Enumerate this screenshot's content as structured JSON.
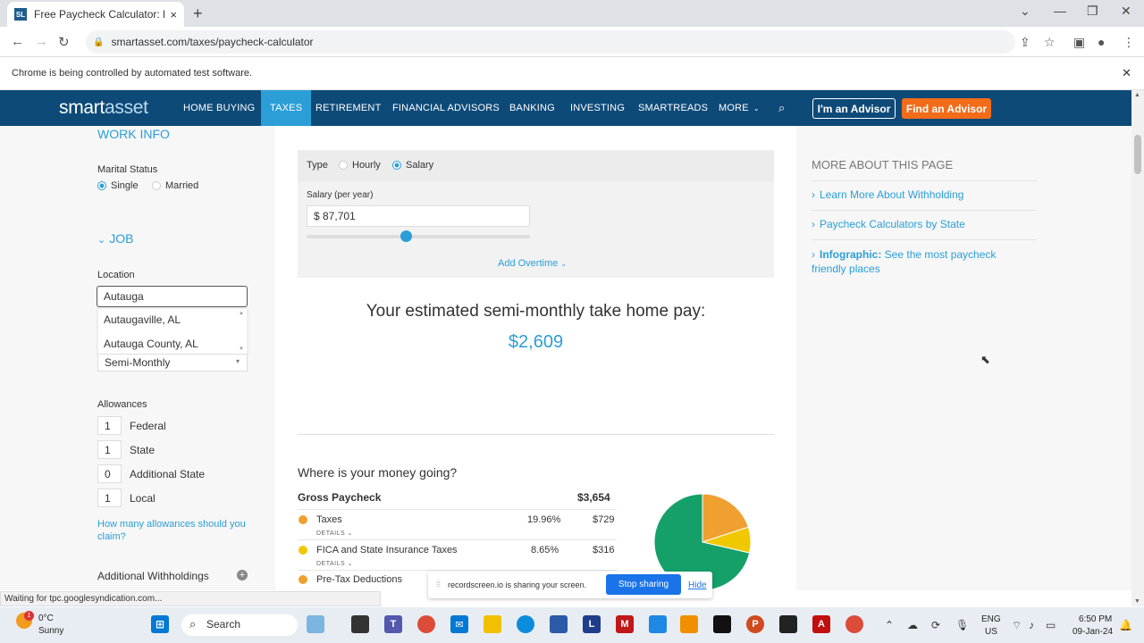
{
  "browser": {
    "tab_title": "Free Paycheck Calculator: Hourl",
    "tab_close": "×",
    "new_tab": "+",
    "url": "smartasset.com/taxes/paycheck-calculator",
    "automation_notice": "Chrome is being controlled by automated test software."
  },
  "site_nav": {
    "logo_a": "smart",
    "logo_b": "asset",
    "items": [
      "HOME BUYING",
      "TAXES",
      "RETIREMENT",
      "FINANCIAL ADVISORS",
      "BANKING",
      "INVESTING",
      "SMARTREADS",
      "MORE"
    ],
    "advisor_btn": "I'm an Advisor",
    "find_btn": "Find an Advisor",
    "accent": "#2b9ed8",
    "nav_bg": "#0e4a78",
    "find_color": "#f26c1a"
  },
  "left": {
    "work_info": "WORK INFO",
    "marital_status": "Marital Status",
    "single": "Single",
    "married": "Married",
    "job": "JOB",
    "location_label": "Location",
    "location_value": "Autauga",
    "suggestions": [
      "Autaugaville, AL",
      "Autauga County, AL"
    ],
    "pay_frequency": "Semi-Monthly",
    "allowances_label": "Allowances",
    "allowances": [
      {
        "value": "1",
        "label": "Federal"
      },
      {
        "value": "1",
        "label": "State"
      },
      {
        "value": "0",
        "label": "Additional State"
      },
      {
        "value": "1",
        "label": "Local"
      }
    ],
    "allowance_link": "How many allowances should you claim?",
    "additional_withholdings": "Additional Withholdings"
  },
  "calc": {
    "type_label": "Type",
    "hourly": "Hourly",
    "salary": "Salary",
    "salary_label": "Salary (per year)",
    "salary_value": "$ 87,701",
    "add_overtime": "Add Overtime",
    "take_home_text": "Your estimated semi-monthly take home pay:",
    "take_home_amount": "$2,609",
    "where_money": "Where is your money going?",
    "gross_label": "Gross Paycheck",
    "gross_amount": "$3,654",
    "details": "DETAILS",
    "rows": [
      {
        "name": "Taxes",
        "pct": "19.96%",
        "amount": "$729",
        "color": "#f0a030"
      },
      {
        "name": "FICA and State Insurance Taxes",
        "pct": "8.65%",
        "amount": "$316",
        "color": "#f0c800"
      },
      {
        "name": "Pre-Tax Deductions",
        "pct": "",
        "amount": "",
        "color": "#f0a030"
      }
    ],
    "pie": [
      {
        "fraction": 0.1996,
        "color": "#f0a030"
      },
      {
        "fraction": 0.0865,
        "color": "#f0c800"
      },
      {
        "fraction": 0.7139,
        "color": "#15a06a"
      }
    ]
  },
  "right": {
    "heading": "MORE ABOUT THIS PAGE",
    "links": [
      {
        "bold": "",
        "text": "Learn More About Withholding"
      },
      {
        "bold": "",
        "text": "Paycheck Calculators by State"
      },
      {
        "bold": "Infographic:",
        "text": "See the most paycheck friendly places"
      }
    ]
  },
  "share": {
    "text": "recordscreen.io is sharing your screen.",
    "stop": "Stop sharing",
    "hide": "Hide"
  },
  "status_text": "Waiting for tpc.googlesyndication.com...",
  "taskbar": {
    "temp": "0°C",
    "weather": "Sunny",
    "badge": "1",
    "search": "Search",
    "lang1": "ENG",
    "lang2": "US",
    "time": "6:50 PM",
    "date": "09-Jan-24"
  }
}
